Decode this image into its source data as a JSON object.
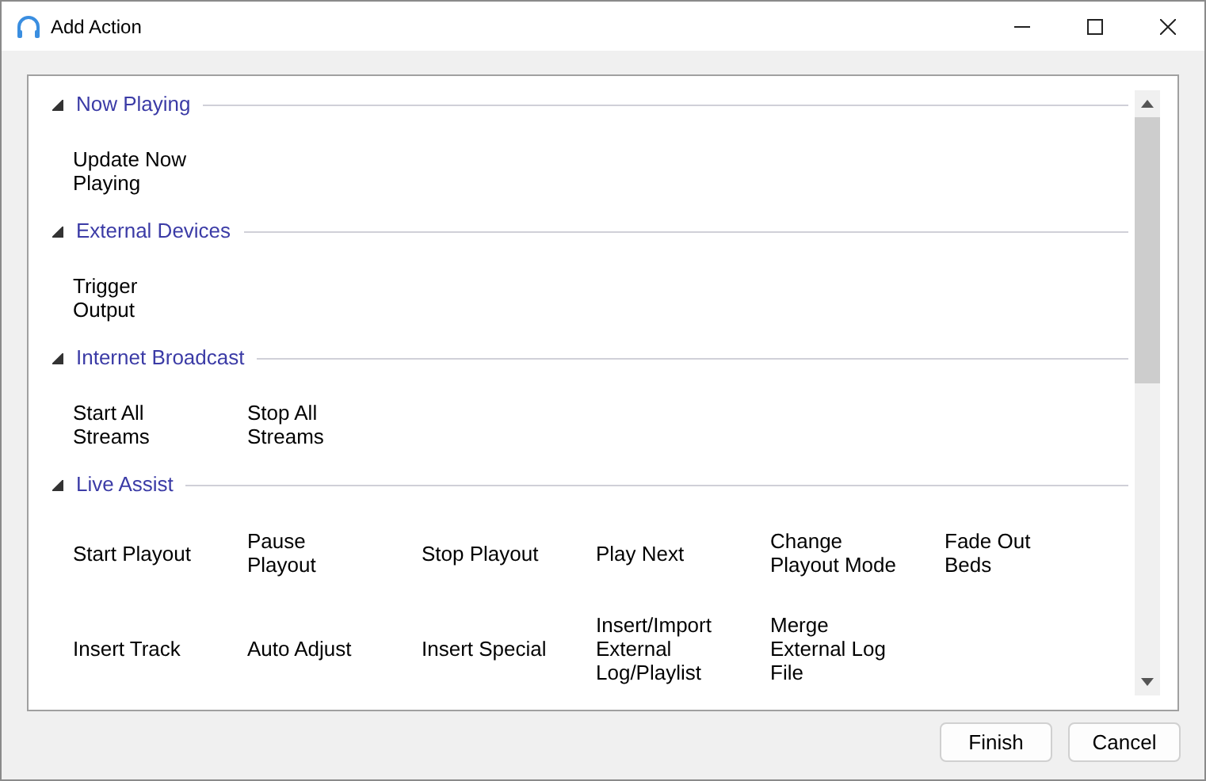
{
  "window": {
    "title": "Add Action"
  },
  "groups": [
    {
      "label": "Now Playing",
      "expanded": true,
      "rows": [
        [
          "Update Now\nPlaying"
        ]
      ]
    },
    {
      "label": "External Devices",
      "expanded": true,
      "rows": [
        [
          "Trigger\nOutput"
        ]
      ]
    },
    {
      "label": "Internet Broadcast",
      "expanded": true,
      "rows": [
        [
          "Start All\nStreams",
          "Stop All\nStreams"
        ]
      ]
    },
    {
      "label": "Live Assist",
      "expanded": true,
      "rows": [
        [
          "Start Playout",
          "Pause\nPlayout",
          "Stop Playout",
          "Play Next",
          "Change\nPlayout Mode",
          "Fade Out\nBeds"
        ],
        [
          "Insert Track",
          "Auto Adjust",
          "Insert Special",
          "Insert/Import\nExternal\nLog/Playlist",
          "Merge\nExternal Log\nFile"
        ]
      ]
    }
  ],
  "buttons": [
    "Finish",
    "Cancel"
  ]
}
